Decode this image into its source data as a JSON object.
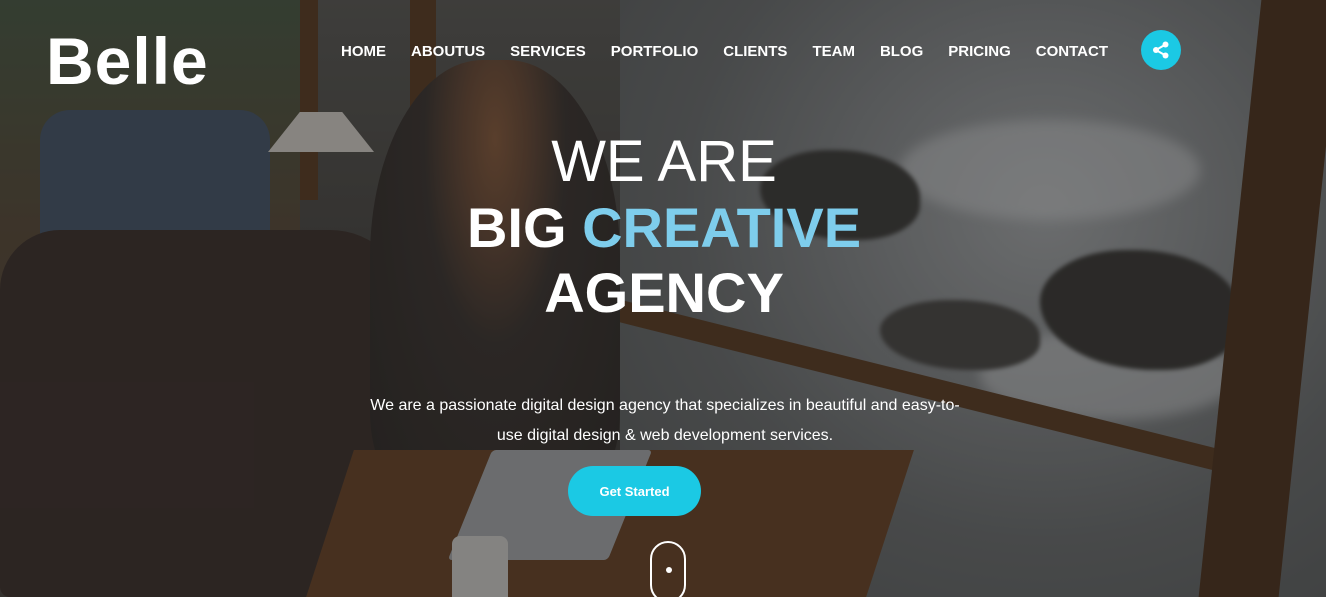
{
  "brand": {
    "logo_text": "Belle"
  },
  "nav": {
    "items": [
      {
        "label": "HOME"
      },
      {
        "label": "ABOUTUS"
      },
      {
        "label": "SERVICES"
      },
      {
        "label": "PORTFOLIO"
      },
      {
        "label": "CLIENTS"
      },
      {
        "label": "TEAM"
      },
      {
        "label": "BLOG"
      },
      {
        "label": "PRICING"
      },
      {
        "label": "CONTACT"
      }
    ],
    "share_icon": "share-icon"
  },
  "hero": {
    "line1": "WE ARE",
    "line2_prefix": "BIG ",
    "line2_accent": "CREATIVE",
    "line3": "AGENCY",
    "description": "We are a passionate digital design agency that specializes in beautiful and easy-to-use digital design & web development services.",
    "cta_label": "Get Started",
    "scroll_icon": "mouse-scroll-icon"
  },
  "colors": {
    "accent": "#1bc9e4",
    "headline_accent": "#7ecdec",
    "text": "#ffffff"
  }
}
